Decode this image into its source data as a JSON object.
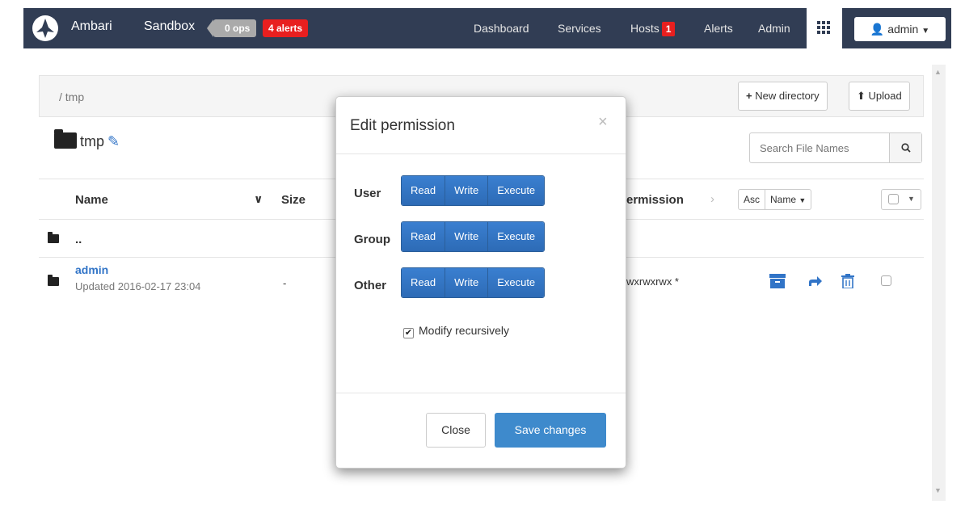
{
  "navbar": {
    "brand": "Ambari",
    "cluster": "Sandbox",
    "ops_badge": "0 ops",
    "alerts_badge": "4 alerts",
    "links": {
      "dashboard": "Dashboard",
      "services": "Services",
      "hosts": "Hosts",
      "alerts": "Alerts",
      "admin": "Admin"
    },
    "hosts_badge": "1",
    "user": "admin"
  },
  "browser": {
    "path": "/  tmp",
    "new_directory": "New directory",
    "upload": "Upload",
    "dir_name": "tmp",
    "search_placeholder": "Search File Names",
    "columns": {
      "name": "Name",
      "size": "Size",
      "permission": "ermission"
    },
    "sort": {
      "asc": "Asc",
      "by": "Name"
    },
    "rows": [
      {
        "name": "..",
        "updated": "",
        "size": "",
        "permission": ""
      },
      {
        "name": "admin",
        "updated": "Updated 2016-02-17 23:04",
        "size": "-",
        "permission": "wxrwxrwx *"
      }
    ]
  },
  "modal": {
    "title": "Edit permission",
    "close_x": "×",
    "labels": {
      "user": "User",
      "group": "Group",
      "other": "Other"
    },
    "buttons": {
      "read": "Read",
      "write": "Write",
      "execute": "Execute"
    },
    "recursive_label": "Modify recursively",
    "close_button": "Close",
    "save_button": "Save changes"
  },
  "colors": {
    "navbar_bg": "#313d54",
    "accent_blue": "#3174c7",
    "alert_red": "#e81f1f",
    "save_blue": "#3e8acc"
  },
  "icons": {
    "logo": "ambari-logo-icon",
    "apps": "grid-apps-icon",
    "user": "user-icon",
    "plus": "plus-icon",
    "upload": "upload-icon",
    "folder": "folder-icon",
    "edit": "edit-icon",
    "search": "search-icon",
    "archive": "archive-icon",
    "move": "move-icon",
    "trash": "trash-icon"
  }
}
